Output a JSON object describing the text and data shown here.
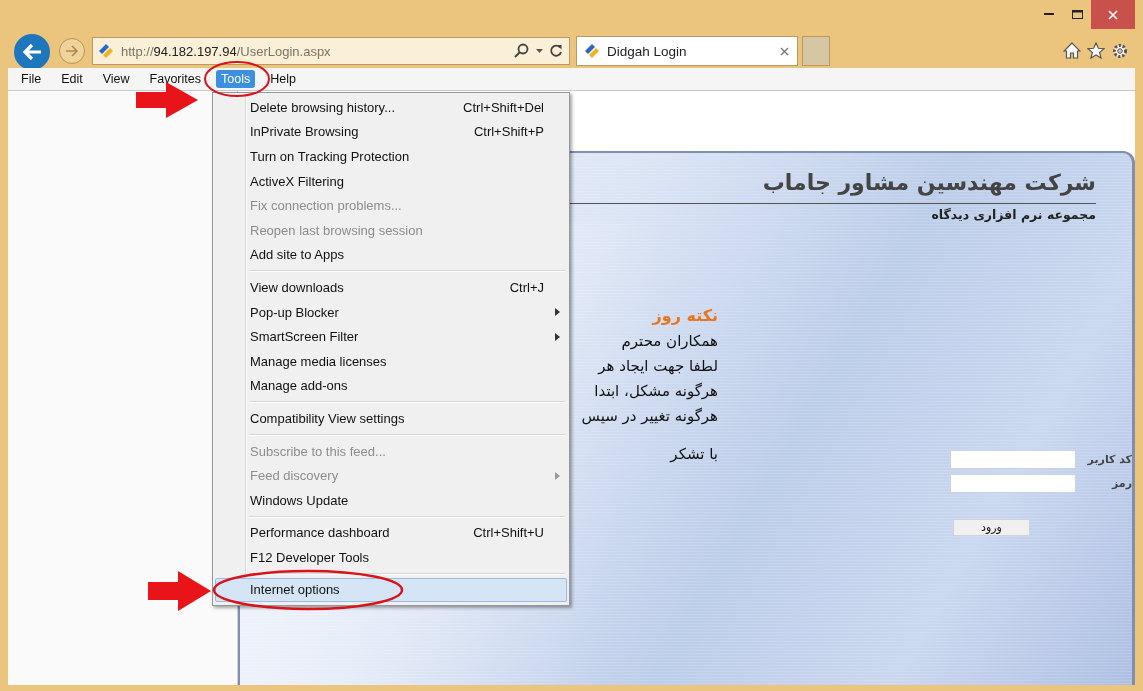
{
  "address_bar": {
    "url_prefix": "http://",
    "url_host": "94.182.197.94",
    "url_path": "/UserLogin.aspx"
  },
  "tabs": [
    {
      "label": "Didgah Login",
      "selected": true
    }
  ],
  "menu_bar": [
    {
      "label": "File",
      "selected": false
    },
    {
      "label": "Edit",
      "selected": false
    },
    {
      "label": "View",
      "selected": false
    },
    {
      "label": "Favorites",
      "selected": false
    },
    {
      "label": "Tools",
      "selected": true
    },
    {
      "label": "Help",
      "selected": false
    }
  ],
  "tools_menu": {
    "groups": [
      {
        "items": [
          {
            "label": "Delete browsing history...",
            "shortcut": "Ctrl+Shift+Del",
            "disabled": false,
            "submenu": false,
            "selected": false
          },
          {
            "label": "InPrivate Browsing",
            "shortcut": "Ctrl+Shift+P",
            "disabled": false,
            "submenu": false,
            "selected": false
          },
          {
            "label": "Turn on Tracking Protection",
            "disabled": false,
            "submenu": false,
            "selected": false
          },
          {
            "label": "ActiveX Filtering",
            "disabled": false,
            "submenu": false,
            "selected": false
          },
          {
            "label": "Fix connection problems...",
            "disabled": true,
            "submenu": false,
            "selected": false
          },
          {
            "label": "Reopen last browsing session",
            "disabled": true,
            "submenu": false,
            "selected": false
          },
          {
            "label": "Add site to Apps",
            "disabled": false,
            "submenu": false,
            "selected": false
          }
        ]
      },
      {
        "items": [
          {
            "label": "View downloads",
            "shortcut": "Ctrl+J",
            "disabled": false,
            "submenu": false,
            "selected": false
          },
          {
            "label": "Pop-up Blocker",
            "disabled": false,
            "submenu": true,
            "selected": false
          },
          {
            "label": "SmartScreen Filter",
            "disabled": false,
            "submenu": true,
            "selected": false
          },
          {
            "label": "Manage media licenses",
            "disabled": false,
            "submenu": false,
            "selected": false
          },
          {
            "label": "Manage add-ons",
            "disabled": false,
            "submenu": false,
            "selected": false
          }
        ]
      },
      {
        "items": [
          {
            "label": "Compatibility View settings",
            "disabled": false,
            "submenu": false,
            "selected": false
          }
        ]
      },
      {
        "items": [
          {
            "label": "Subscribe to this feed...",
            "disabled": true,
            "submenu": false,
            "selected": false
          },
          {
            "label": "Feed discovery",
            "disabled": true,
            "submenu": true,
            "selected": false
          },
          {
            "label": "Windows Update",
            "disabled": false,
            "submenu": false,
            "selected": false
          }
        ]
      },
      {
        "items": [
          {
            "label": "Performance dashboard",
            "shortcut": "Ctrl+Shift+U",
            "disabled": false,
            "submenu": false,
            "selected": false
          },
          {
            "label": "F12 Developer Tools",
            "disabled": false,
            "submenu": false,
            "selected": false
          }
        ]
      },
      {
        "items": [
          {
            "label": "Internet options",
            "disabled": false,
            "submenu": false,
            "selected": true
          }
        ]
      }
    ]
  },
  "login_page": {
    "company": "شرکت مهندسین مشاور جاماب",
    "subtitle": "مجموعه نرم افزاری دیدگاه",
    "tip_title": "نکته روز",
    "tip_lines": [
      "همکاران محترم",
      "لطفا جهت ایجاد هر",
      "هرگونه مشکل، ابتدا",
      "هرگونه تغییر در سیس"
    ],
    "closing": "با تشکر",
    "fields": [
      {
        "label": "کد کاربر"
      },
      {
        "label": "رمز"
      }
    ],
    "submit": "ورود"
  }
}
